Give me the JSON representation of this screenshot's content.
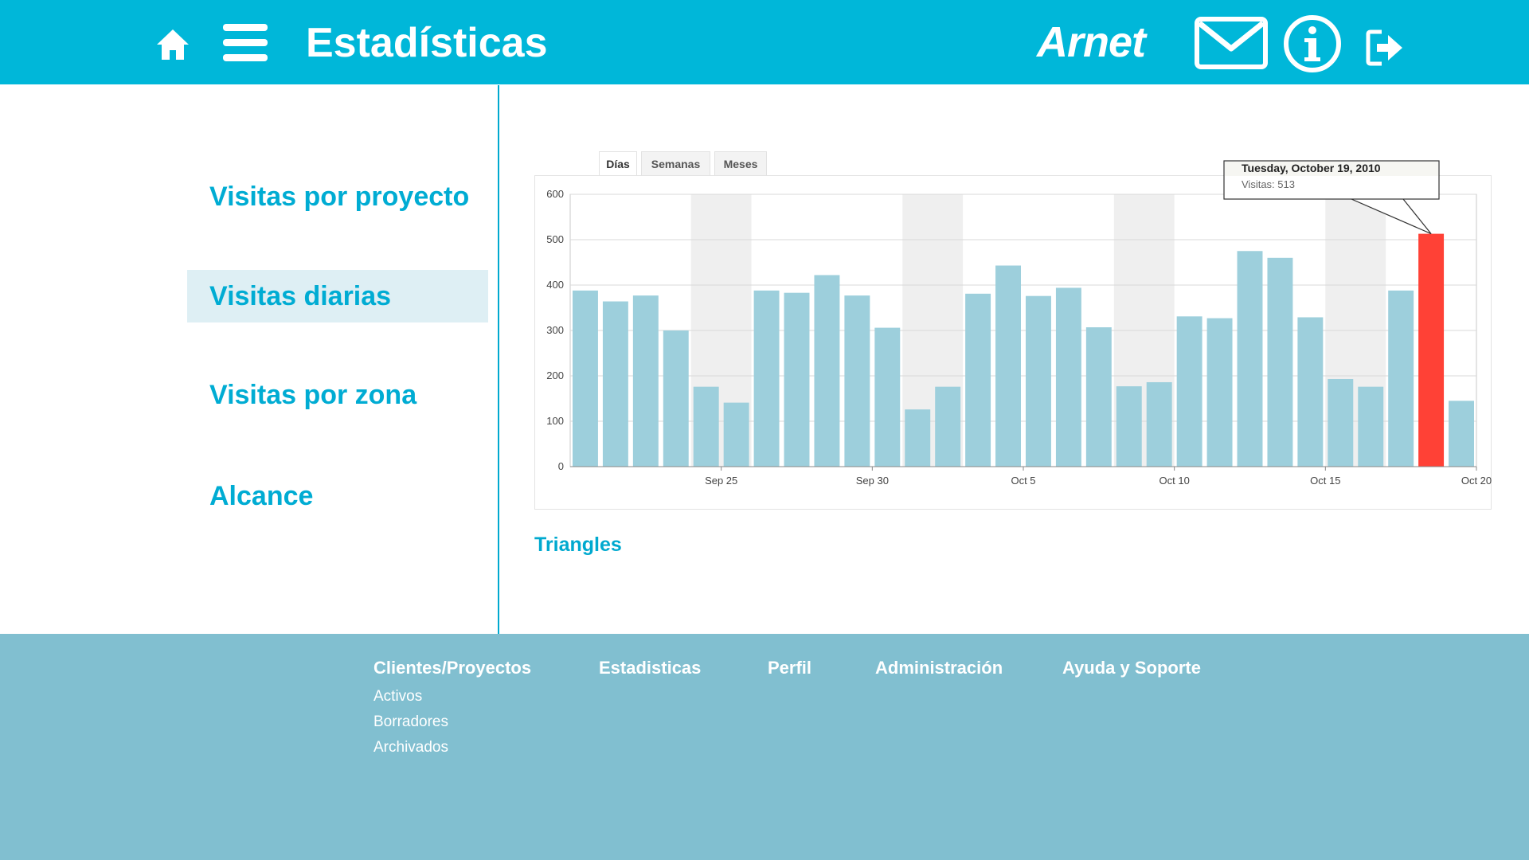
{
  "header": {
    "title": "Estadísticas",
    "brand": "Arnet"
  },
  "sidebar": {
    "items": [
      {
        "label": "Visitas por proyecto",
        "active": false
      },
      {
        "label": "Visitas diarias",
        "active": true
      },
      {
        "label": "Visitas por zona",
        "active": false
      },
      {
        "label": "Alcance",
        "active": false
      }
    ]
  },
  "chart_tabs": [
    "Días",
    "Semanas",
    "Meses"
  ],
  "chart_tabs_active": "Días",
  "caption": "Triangles",
  "tooltip": {
    "date": "Tuesday, October 19, 2010",
    "value_label": "Visitas: 513"
  },
  "colors": {
    "accent": "#00b7d9",
    "bar": "#9dcfdc",
    "highlight": "#ff4136",
    "weekend_band": "#efefef",
    "footer": "#81bfd0"
  },
  "chart_data": {
    "type": "bar",
    "categories": [
      "Sep 21",
      "Sep 22",
      "Sep 23",
      "Sep 24",
      "Sep 25",
      "Sep 26",
      "Sep 27",
      "Sep 28",
      "Sep 29",
      "Sep 30",
      "Oct 1",
      "Oct 2",
      "Oct 3",
      "Oct 4",
      "Oct 5",
      "Oct 6",
      "Oct 7",
      "Oct 8",
      "Oct 9",
      "Oct 10",
      "Oct 11",
      "Oct 12",
      "Oct 13",
      "Oct 14",
      "Oct 15",
      "Oct 16",
      "Oct 17",
      "Oct 18",
      "Oct 19",
      "Oct 20"
    ],
    "values": [
      388,
      364,
      377,
      300,
      176,
      141,
      388,
      383,
      422,
      377,
      306,
      126,
      176,
      381,
      443,
      376,
      394,
      307,
      177,
      186,
      331,
      327,
      475,
      460,
      329,
      193,
      176,
      388,
      513,
      145
    ],
    "highlighted": "Oct 19",
    "x_tick_labels": [
      "Sep 25",
      "Sep 30",
      "Oct 5",
      "Oct 10",
      "Oct 15",
      "Oct 20"
    ],
    "y_ticks": [
      0,
      100,
      200,
      300,
      400,
      500,
      600
    ],
    "ylim": [
      0,
      600
    ],
    "weekend_bands": [
      [
        "Sep 25",
        "Sep 26"
      ],
      [
        "Oct 2",
        "Oct 3"
      ],
      [
        "Oct 9",
        "Oct 10"
      ],
      [
        "Oct 16",
        "Oct 17"
      ]
    ],
    "grid": true
  },
  "footer": {
    "columns": [
      {
        "heading": "Clientes/Proyectos",
        "links": [
          "Activos",
          "Borradores",
          "Archivados"
        ]
      },
      {
        "heading": "Estadisticas",
        "links": []
      },
      {
        "heading": "Perfil",
        "links": []
      },
      {
        "heading": "Administración",
        "links": []
      },
      {
        "heading": "Ayuda y Soporte",
        "links": []
      }
    ]
  }
}
